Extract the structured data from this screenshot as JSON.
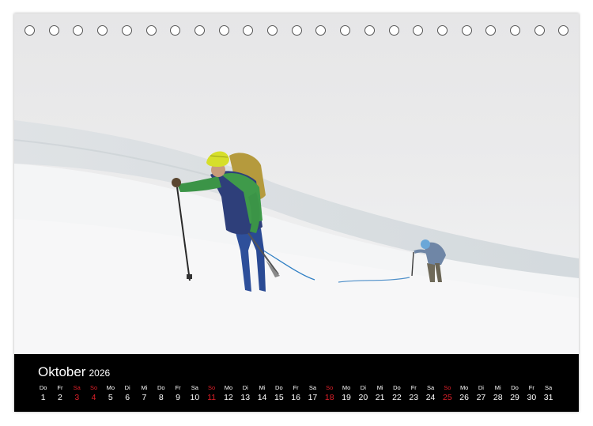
{
  "calendar": {
    "month": "Oktober",
    "year": "2026",
    "days": [
      {
        "dn": "Do",
        "dd": "1",
        "red": false
      },
      {
        "dn": "Fr",
        "dd": "2",
        "red": false
      },
      {
        "dn": "Sa",
        "dd": "3",
        "red": true
      },
      {
        "dn": "So",
        "dd": "4",
        "red": true
      },
      {
        "dn": "Mo",
        "dd": "5",
        "red": false
      },
      {
        "dn": "Di",
        "dd": "6",
        "red": false
      },
      {
        "dn": "Mi",
        "dd": "7",
        "red": false
      },
      {
        "dn": "Do",
        "dd": "8",
        "red": false
      },
      {
        "dn": "Fr",
        "dd": "9",
        "red": false
      },
      {
        "dn": "Sa",
        "dd": "10",
        "red": false
      },
      {
        "dn": "So",
        "dd": "11",
        "red": true
      },
      {
        "dn": "Mo",
        "dd": "12",
        "red": false
      },
      {
        "dn": "Di",
        "dd": "13",
        "red": false
      },
      {
        "dn": "Mi",
        "dd": "14",
        "red": false
      },
      {
        "dn": "Do",
        "dd": "15",
        "red": false
      },
      {
        "dn": "Fr",
        "dd": "16",
        "red": false
      },
      {
        "dn": "Sa",
        "dd": "17",
        "red": false
      },
      {
        "dn": "So",
        "dd": "18",
        "red": true
      },
      {
        "dn": "Mo",
        "dd": "19",
        "red": false
      },
      {
        "dn": "Di",
        "dd": "20",
        "red": false
      },
      {
        "dn": "Mi",
        "dd": "21",
        "red": false
      },
      {
        "dn": "Do",
        "dd": "22",
        "red": false
      },
      {
        "dn": "Fr",
        "dd": "23",
        "red": false
      },
      {
        "dn": "Sa",
        "dd": "24",
        "red": false
      },
      {
        "dn": "So",
        "dd": "25",
        "red": true
      },
      {
        "dn": "Mo",
        "dd": "26",
        "red": false
      },
      {
        "dn": "Di",
        "dd": "27",
        "red": false
      },
      {
        "dn": "Mi",
        "dd": "28",
        "red": false
      },
      {
        "dn": "Do",
        "dd": "29",
        "red": false
      },
      {
        "dn": "Fr",
        "dd": "30",
        "red": false
      },
      {
        "dn": "Sa",
        "dd": "31",
        "red": false
      }
    ]
  },
  "colors": {
    "weekend_red": "#e0202a",
    "calendar_bar": "#000000",
    "fog": "#e9eaeb"
  }
}
